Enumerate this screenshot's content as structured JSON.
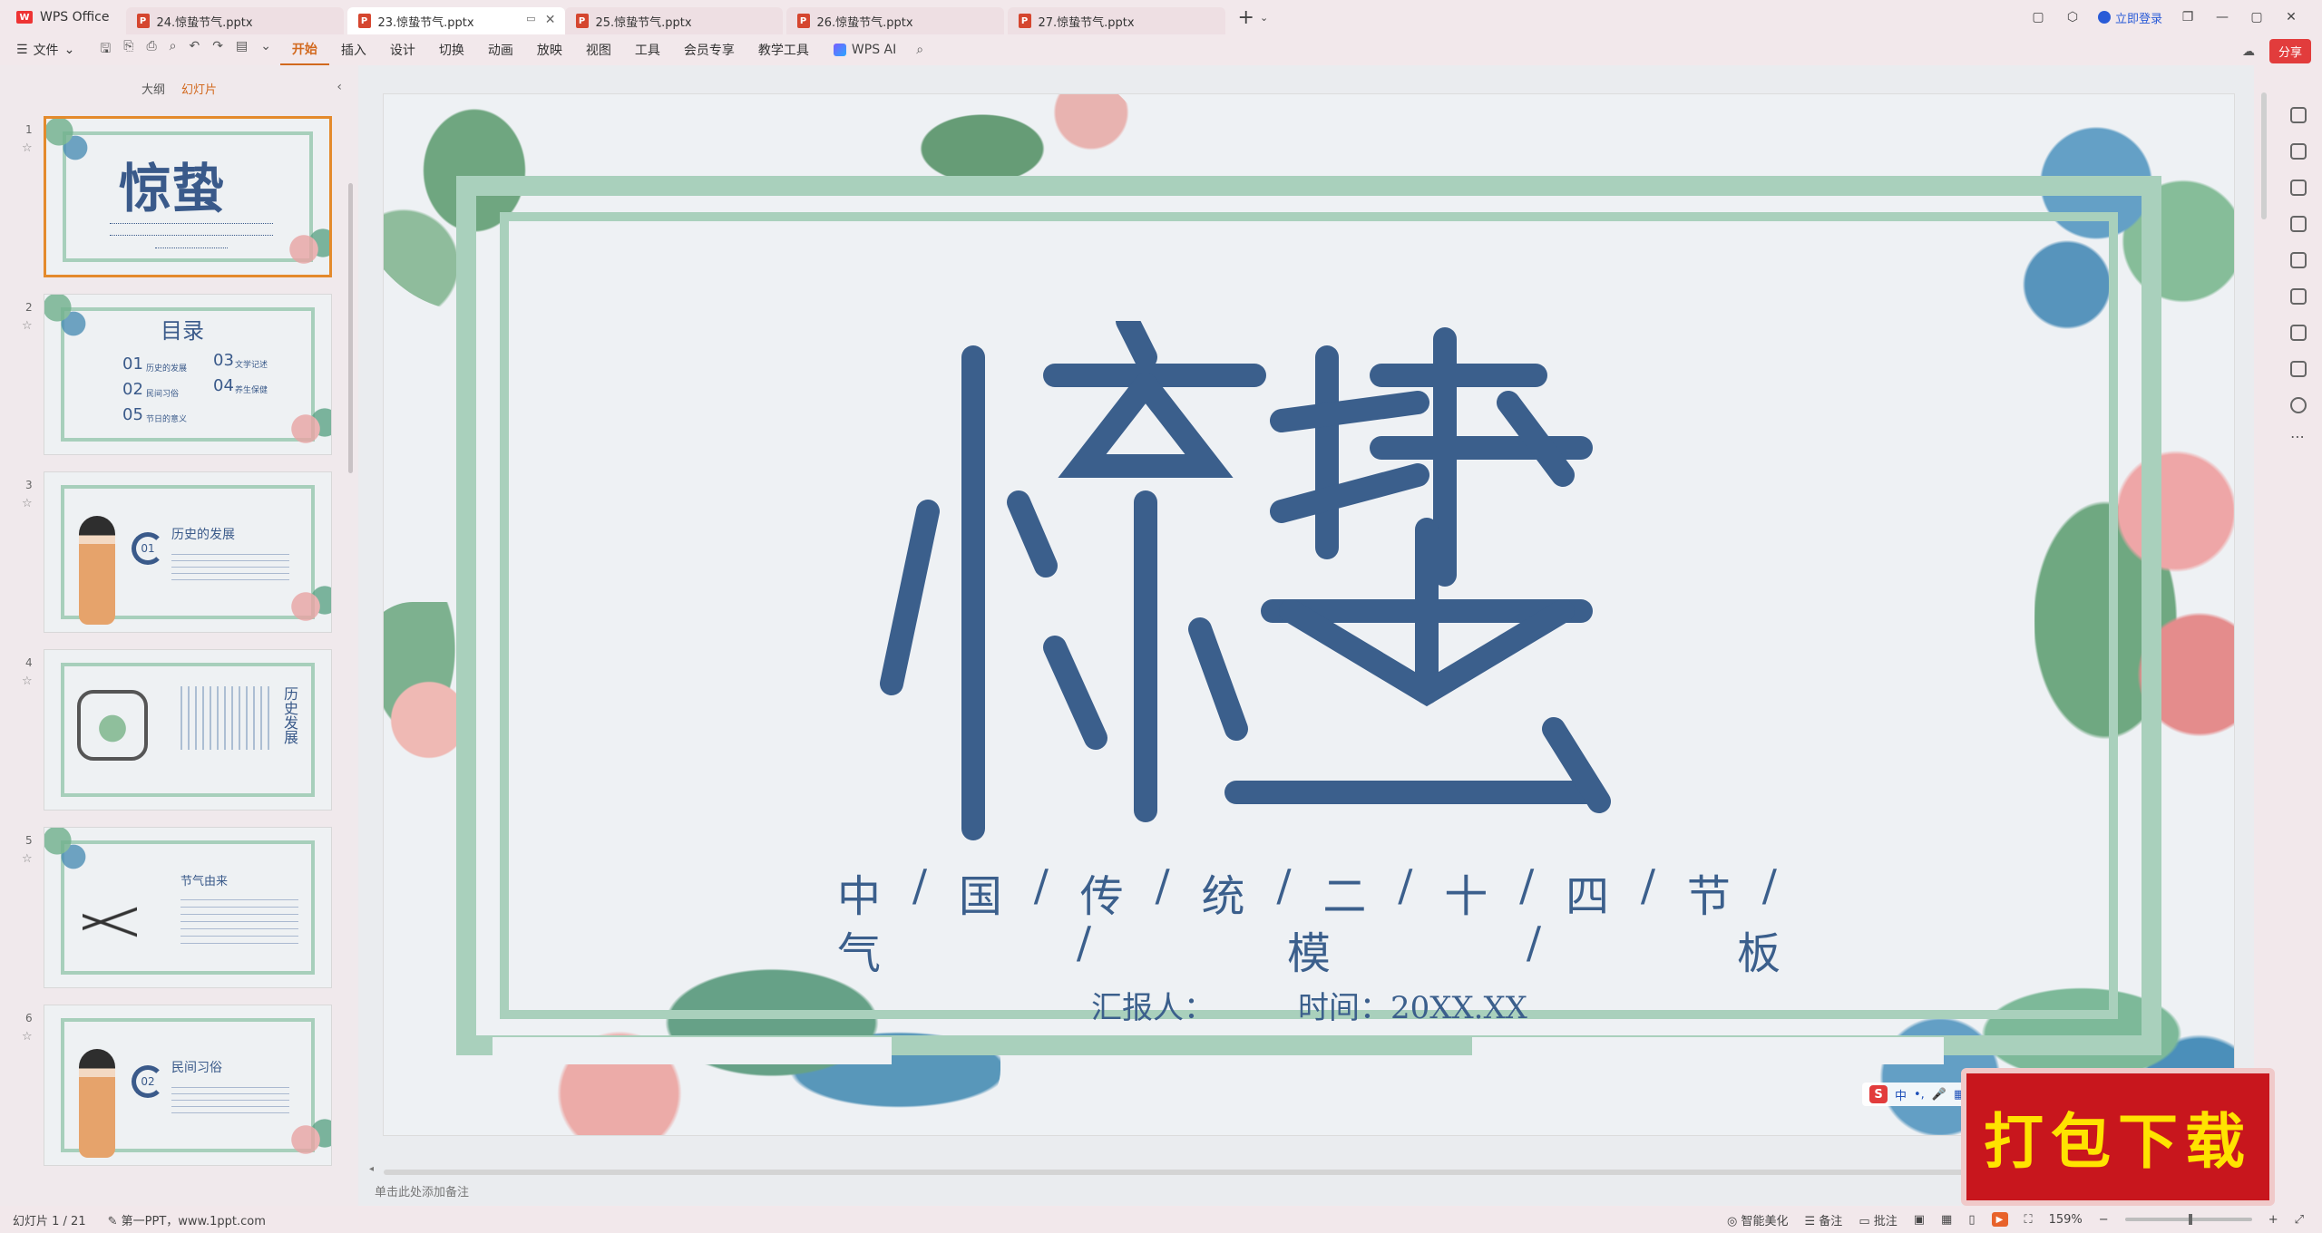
{
  "titlebar": {
    "app_name": "WPS Office",
    "tabs": [
      {
        "label": "24.惊蛰节气.pptx",
        "active": false
      },
      {
        "label": "23.惊蛰节气.pptx",
        "active": true
      },
      {
        "label": "25.惊蛰节气.pptx",
        "active": false
      },
      {
        "label": "26.惊蛰节气.pptx",
        "active": false
      },
      {
        "label": "27.惊蛰节气.pptx",
        "active": false
      }
    ],
    "login_label": "立即登录"
  },
  "ribbon": {
    "file_label": "文件",
    "tabs": [
      "开始",
      "插入",
      "设计",
      "切换",
      "动画",
      "放映",
      "视图",
      "工具",
      "会员专享",
      "教学工具"
    ],
    "active_tab": "开始",
    "wps_ai_label": "WPS AI",
    "share_label": "分享"
  },
  "left_panel": {
    "outline_label": "大纲",
    "slides_label": "幻灯片",
    "slides": [
      {
        "num": "1",
        "title": "惊蛰",
        "selected": true
      },
      {
        "num": "2",
        "title": "目录",
        "items": [
          {
            "n": "01",
            "t": "历史的发展"
          },
          {
            "n": "02",
            "t": "民间习俗"
          },
          {
            "n": "03",
            "t": "文学记述"
          },
          {
            "n": "04",
            "t": "养生保健"
          },
          {
            "n": "05",
            "t": "节日的意义"
          }
        ]
      },
      {
        "num": "3",
        "badge": "01",
        "title": "历史的发展"
      },
      {
        "num": "4",
        "title": "历史发展"
      },
      {
        "num": "5",
        "title": "节气由来"
      },
      {
        "num": "6",
        "badge": "02",
        "title": "民间习俗"
      }
    ]
  },
  "slide": {
    "title": "惊蛰",
    "subtitle_line1": [
      "中",
      "/",
      "国",
      "/",
      "传",
      "/",
      "统",
      "/",
      "二",
      "/",
      "十",
      "/",
      "四",
      "/",
      "节",
      "/"
    ],
    "subtitle_line2": [
      "气",
      "/",
      "模",
      "/",
      "板"
    ],
    "reporter": "汇报人：",
    "time": "时间：20XX.XX",
    "title_color": "#3b5f8c",
    "frame_color": "#a9d0bc"
  },
  "notes_placeholder": "单击此处添加备注",
  "download_badge": "打包下载",
  "statusbar": {
    "slide_indicator": "幻灯片 1 / 21",
    "theme": "第一PPT，www.1ppt.com",
    "smart_beautify": "智能美化",
    "notes": "备注",
    "comments": "批注",
    "zoom": "159%",
    "zoom_fraction": 0.52
  }
}
